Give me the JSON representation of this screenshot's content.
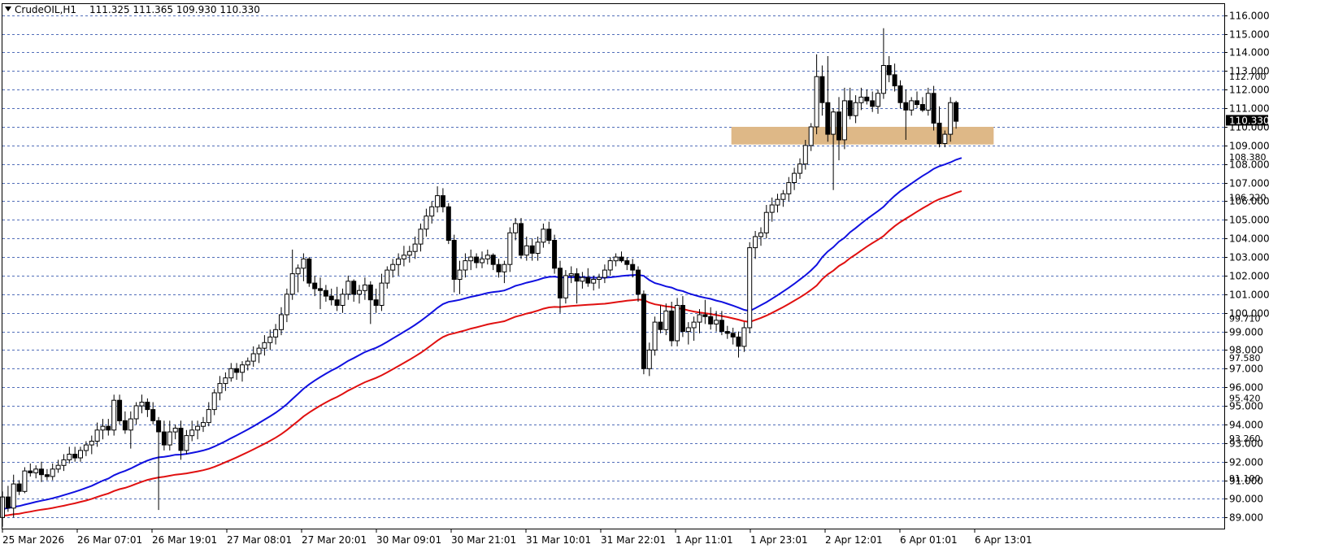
{
  "header": {
    "symbol_label": "CrudeOIL,H1",
    "ohlc": "111.325 111.365 109.930 110.330"
  },
  "colors": {
    "background": "#ffffff",
    "grid": "#1a3fa3",
    "ma_fast": "#1010e0",
    "ma_slow": "#e01010",
    "zone": "#deb887",
    "candle_up_fill": "#ffffff",
    "candle_down_fill": "#000000"
  },
  "chart_data": {
    "type": "candlestick",
    "ylim": [
      88.4,
      116.6
    ],
    "grid": true,
    "y_ticks": [
      116,
      115,
      114,
      113,
      112,
      111,
      110,
      109,
      108,
      107,
      106,
      105,
      104,
      103,
      102,
      101,
      100,
      99,
      98,
      97,
      96,
      95,
      94,
      93,
      92,
      91,
      90,
      89
    ],
    "y_tick_labels": [
      "116.000",
      "115.000",
      "114.000",
      "113.000",
      "112.000",
      "111.000",
      "110.000",
      "109.000",
      "108.000",
      "107.000",
      "106.000",
      "105.000",
      "104.000",
      "103.000",
      "102.000",
      "101.000",
      "100.000",
      "99.000",
      "98.000",
      "97.000",
      "96.000",
      "95.000",
      "94.000",
      "93.000",
      "92.000",
      "91.000",
      "90.000",
      "89.000"
    ],
    "extra_price_labels": [
      {
        "label": "112.700",
        "value": 112.7
      },
      {
        "label": "108.380",
        "value": 108.38
      },
      {
        "label": "106.220",
        "value": 106.22
      },
      {
        "label": "99.710",
        "value": 99.71
      },
      {
        "label": "97.580",
        "value": 97.58
      },
      {
        "label": "95.420",
        "value": 95.42
      },
      {
        "label": "93.260",
        "value": 93.26
      },
      {
        "label": "91.100",
        "value": 91.1
      }
    ],
    "current_price": {
      "label": "110.330",
      "value": 110.33
    },
    "x_labels": [
      "25 Mar 2026",
      "26 Mar 07:01",
      "26 Mar 19:01",
      "27 Mar 08:01",
      "27 Mar 20:01",
      "30 Mar 09:01",
      "30 Mar 21:01",
      "31 Mar 10:01",
      "31 Mar 22:01",
      "1 Apr 11:01",
      "1 Apr 23:01",
      "2 Apr 12:01",
      "6 Apr 01:01",
      "6 Apr 13:01"
    ],
    "zone": {
      "low": 109.05,
      "high": 110.0,
      "from_bar": 131,
      "to_bar": 176
    },
    "candles": [
      [
        89.0,
        90.4,
        88.5,
        90.1
      ],
      [
        90.1,
        90.7,
        89.3,
        89.5
      ],
      [
        89.5,
        91.3,
        89.0,
        90.8
      ],
      [
        90.8,
        91.0,
        90.2,
        90.4
      ],
      [
        90.4,
        91.7,
        90.3,
        91.5
      ],
      [
        91.5,
        91.9,
        91.2,
        91.4
      ],
      [
        91.4,
        91.8,
        91.1,
        91.6
      ],
      [
        91.6,
        92.0,
        90.9,
        91.3
      ],
      [
        91.3,
        91.6,
        91.0,
        91.2
      ],
      [
        91.2,
        91.9,
        91.0,
        91.6
      ],
      [
        91.6,
        92.1,
        91.4,
        91.8
      ],
      [
        91.8,
        92.4,
        91.5,
        92.1
      ],
      [
        92.1,
        92.8,
        91.9,
        92.4
      ],
      [
        92.4,
        92.8,
        92.0,
        92.2
      ],
      [
        92.2,
        92.8,
        92.0,
        92.6
      ],
      [
        92.6,
        93.1,
        92.3,
        92.9
      ],
      [
        92.9,
        93.4,
        92.4,
        93.1
      ],
      [
        93.1,
        94.1,
        92.8,
        93.7
      ],
      [
        93.7,
        94.3,
        93.2,
        93.9
      ],
      [
        93.9,
        94.3,
        93.4,
        93.7
      ],
      [
        93.7,
        95.6,
        93.4,
        95.3
      ],
      [
        95.3,
        95.6,
        94.0,
        94.2
      ],
      [
        94.2,
        94.7,
        93.5,
        93.7
      ],
      [
        93.7,
        94.7,
        92.7,
        94.3
      ],
      [
        94.3,
        95.2,
        94.0,
        95.0
      ],
      [
        95.0,
        95.6,
        94.6,
        95.2
      ],
      [
        95.2,
        95.4,
        94.4,
        94.8
      ],
      [
        94.8,
        95.2,
        94.0,
        94.2
      ],
      [
        94.2,
        94.4,
        89.4,
        93.6
      ],
      [
        93.6,
        94.2,
        92.6,
        92.9
      ],
      [
        92.9,
        94.2,
        92.6,
        93.6
      ],
      [
        93.6,
        94.0,
        93.2,
        93.8
      ],
      [
        93.8,
        94.2,
        92.1,
        92.6
      ],
      [
        92.6,
        93.7,
        92.4,
        93.4
      ],
      [
        93.4,
        94.2,
        93.1,
        93.7
      ],
      [
        93.7,
        94.2,
        93.2,
        93.9
      ],
      [
        93.9,
        94.4,
        93.6,
        94.1
      ],
      [
        94.1,
        95.2,
        93.9,
        94.8
      ],
      [
        94.8,
        95.9,
        94.5,
        95.7
      ],
      [
        95.7,
        96.6,
        95.3,
        96.2
      ],
      [
        96.2,
        96.8,
        95.8,
        96.5
      ],
      [
        96.5,
        97.3,
        96.3,
        97.0
      ],
      [
        97.0,
        97.3,
        96.4,
        96.8
      ],
      [
        96.8,
        97.4,
        96.3,
        97.2
      ],
      [
        97.2,
        97.6,
        96.9,
        97.4
      ],
      [
        97.4,
        98.2,
        97.1,
        97.8
      ],
      [
        97.8,
        98.3,
        97.3,
        98.1
      ],
      [
        98.1,
        98.8,
        97.7,
        98.4
      ],
      [
        98.4,
        99.1,
        98.0,
        98.7
      ],
      [
        98.7,
        99.4,
        98.3,
        99.1
      ],
      [
        99.1,
        100.3,
        98.8,
        99.9
      ],
      [
        99.9,
        101.3,
        99.5,
        101.0
      ],
      [
        101.0,
        103.4,
        100.7,
        102.1
      ],
      [
        102.1,
        102.6,
        101.1,
        102.4
      ],
      [
        102.4,
        103.2,
        101.7,
        102.9
      ],
      [
        102.9,
        103.0,
        101.4,
        101.6
      ],
      [
        101.6,
        102.0,
        100.9,
        101.3
      ],
      [
        101.3,
        101.9,
        100.2,
        101.2
      ],
      [
        101.2,
        101.5,
        100.6,
        100.9
      ],
      [
        100.9,
        101.3,
        100.4,
        100.7
      ],
      [
        100.7,
        101.4,
        100.1,
        100.4
      ],
      [
        100.4,
        101.3,
        100.0,
        101.0
      ],
      [
        101.0,
        102.0,
        100.7,
        101.7
      ],
      [
        101.7,
        101.8,
        100.6,
        101.0
      ],
      [
        101.0,
        101.5,
        100.5,
        101.2
      ],
      [
        101.2,
        101.9,
        100.7,
        101.5
      ],
      [
        101.5,
        101.7,
        99.4,
        100.7
      ],
      [
        100.7,
        101.3,
        100.0,
        100.4
      ],
      [
        100.4,
        102.1,
        100.1,
        101.6
      ],
      [
        101.6,
        102.5,
        101.3,
        102.3
      ],
      [
        102.3,
        102.9,
        101.9,
        102.6
      ],
      [
        102.6,
        103.2,
        102.0,
        102.9
      ],
      [
        102.9,
        103.6,
        102.5,
        103.1
      ],
      [
        103.1,
        103.6,
        102.7,
        103.3
      ],
      [
        103.3,
        104.1,
        102.9,
        103.7
      ],
      [
        103.7,
        104.8,
        103.3,
        104.5
      ],
      [
        104.5,
        105.6,
        104.1,
        105.2
      ],
      [
        105.2,
        106.0,
        104.8,
        105.7
      ],
      [
        105.7,
        106.8,
        105.4,
        106.3
      ],
      [
        106.3,
        106.7,
        105.4,
        105.7
      ],
      [
        105.7,
        105.9,
        103.7,
        103.9
      ],
      [
        103.9,
        104.2,
        101.1,
        101.8
      ],
      [
        101.8,
        102.8,
        101.0,
        102.3
      ],
      [
        102.3,
        103.2,
        101.9,
        102.8
      ],
      [
        102.8,
        103.4,
        102.3,
        103.0
      ],
      [
        103.0,
        103.2,
        102.4,
        102.7
      ],
      [
        102.7,
        103.3,
        102.4,
        102.9
      ],
      [
        102.9,
        103.4,
        102.6,
        103.1
      ],
      [
        103.1,
        103.2,
        102.3,
        102.6
      ],
      [
        102.6,
        102.9,
        101.9,
        102.2
      ],
      [
        102.2,
        102.8,
        101.6,
        102.6
      ],
      [
        102.6,
        104.6,
        102.2,
        104.3
      ],
      [
        104.3,
        105.1,
        103.9,
        104.8
      ],
      [
        104.8,
        105.1,
        102.9,
        103.1
      ],
      [
        103.1,
        104.1,
        102.8,
        103.6
      ],
      [
        103.6,
        104.0,
        102.8,
        103.2
      ],
      [
        103.2,
        104.1,
        102.8,
        103.8
      ],
      [
        103.8,
        104.8,
        103.5,
        104.5
      ],
      [
        104.5,
        104.9,
        103.7,
        103.9
      ],
      [
        103.9,
        104.2,
        102.1,
        102.4
      ],
      [
        102.4,
        102.8,
        100.0,
        100.8
      ],
      [
        100.8,
        102.3,
        100.5,
        102.0
      ],
      [
        102.0,
        102.5,
        101.6,
        102.1
      ],
      [
        102.1,
        102.4,
        100.5,
        101.7
      ],
      [
        101.7,
        102.2,
        101.3,
        101.9
      ],
      [
        101.9,
        102.4,
        101.4,
        101.6
      ],
      [
        101.6,
        102.0,
        101.2,
        101.8
      ],
      [
        101.8,
        102.1,
        101.3,
        101.9
      ],
      [
        101.9,
        102.6,
        101.6,
        102.3
      ],
      [
        102.3,
        103.0,
        102.0,
        102.8
      ],
      [
        102.8,
        103.2,
        102.5,
        103.0
      ],
      [
        103.0,
        103.3,
        102.7,
        102.8
      ],
      [
        102.8,
        103.0,
        102.3,
        102.6
      ],
      [
        102.6,
        102.9,
        101.9,
        102.3
      ],
      [
        102.3,
        102.5,
        100.6,
        101.0
      ],
      [
        101.0,
        101.2,
        96.7,
        97.0
      ],
      [
        97.0,
        98.4,
        96.6,
        98.0
      ],
      [
        98.0,
        99.8,
        97.7,
        99.5
      ],
      [
        99.5,
        100.4,
        98.9,
        99.1
      ],
      [
        99.1,
        100.5,
        98.8,
        100.1
      ],
      [
        100.1,
        100.6,
        98.2,
        98.5
      ],
      [
        98.5,
        100.8,
        98.2,
        100.4
      ],
      [
        100.4,
        100.9,
        98.7,
        99.0
      ],
      [
        99.0,
        99.5,
        98.3,
        99.2
      ],
      [
        99.2,
        99.8,
        98.5,
        99.5
      ],
      [
        99.5,
        100.2,
        98.9,
        99.9
      ],
      [
        99.9,
        100.7,
        99.4,
        99.8
      ],
      [
        99.8,
        100.3,
        99.1,
        99.4
      ],
      [
        99.4,
        100.1,
        99.0,
        99.6
      ],
      [
        99.6,
        100.1,
        98.8,
        99.0
      ],
      [
        99.0,
        99.3,
        98.6,
        98.9
      ],
      [
        98.9,
        99.2,
        98.3,
        98.7
      ],
      [
        98.7,
        99.0,
        97.6,
        98.2
      ],
      [
        98.2,
        99.5,
        97.9,
        99.2
      ],
      [
        99.2,
        103.8,
        98.9,
        103.5
      ],
      [
        103.5,
        104.4,
        102.9,
        104.1
      ],
      [
        104.1,
        104.6,
        103.6,
        104.3
      ],
      [
        104.3,
        105.8,
        104.0,
        105.4
      ],
      [
        105.4,
        106.2,
        104.9,
        105.8
      ],
      [
        105.8,
        106.4,
        105.4,
        106.1
      ],
      [
        106.1,
        106.6,
        105.7,
        106.4
      ],
      [
        106.4,
        107.3,
        106.0,
        107.0
      ],
      [
        107.0,
        107.8,
        106.6,
        107.5
      ],
      [
        107.5,
        108.3,
        107.2,
        108.0
      ],
      [
        108.0,
        109.3,
        107.7,
        109.0
      ],
      [
        109.0,
        110.2,
        108.7,
        110.0
      ],
      [
        110.0,
        113.9,
        109.6,
        112.7
      ],
      [
        112.7,
        113.3,
        110.6,
        111.3
      ],
      [
        111.3,
        113.8,
        109.2,
        109.6
      ],
      [
        109.6,
        111.0,
        106.6,
        110.8
      ],
      [
        110.8,
        111.6,
        108.2,
        109.3
      ],
      [
        109.3,
        112.1,
        108.8,
        111.4
      ],
      [
        111.4,
        112.1,
        110.4,
        110.6
      ],
      [
        110.6,
        111.7,
        110.2,
        111.3
      ],
      [
        111.3,
        112.1,
        110.9,
        111.6
      ],
      [
        111.6,
        112.0,
        111.2,
        111.4
      ],
      [
        111.4,
        111.9,
        110.8,
        111.1
      ],
      [
        111.1,
        112.0,
        110.7,
        111.8
      ],
      [
        111.8,
        115.3,
        111.5,
        113.3
      ],
      [
        113.3,
        113.8,
        112.4,
        112.8
      ],
      [
        112.8,
        113.4,
        111.9,
        112.2
      ],
      [
        112.2,
        112.5,
        111.0,
        111.3
      ],
      [
        111.3,
        112.0,
        109.3,
        110.9
      ],
      [
        110.9,
        111.6,
        110.6,
        111.4
      ],
      [
        111.4,
        111.9,
        111.0,
        111.2
      ],
      [
        111.2,
        111.6,
        110.8,
        110.9
      ],
      [
        110.9,
        112.1,
        110.6,
        111.8
      ],
      [
        111.8,
        112.2,
        109.8,
        110.2
      ],
      [
        110.2,
        111.1,
        108.9,
        109.1
      ],
      [
        109.1,
        109.8,
        108.9,
        109.6
      ],
      [
        109.6,
        111.6,
        109.2,
        111.3
      ],
      [
        111.3,
        111.4,
        109.9,
        110.3
      ]
    ],
    "ma_fast": [
      89.45,
      89.5,
      89.57,
      89.61,
      89.69,
      89.76,
      89.84,
      89.9,
      89.96,
      90.03,
      90.11,
      90.2,
      90.29,
      90.38,
      90.48,
      90.59,
      90.7,
      90.84,
      90.98,
      91.09,
      91.27,
      91.4,
      91.5,
      91.63,
      91.78,
      91.93,
      92.06,
      92.16,
      92.23,
      92.26,
      92.31,
      92.37,
      92.38,
      92.42,
      92.47,
      92.53,
      92.6,
      92.69,
      92.81,
      92.95,
      93.1,
      93.26,
      93.41,
      93.57,
      93.73,
      93.9,
      94.08,
      94.26,
      94.44,
      94.63,
      94.85,
      95.09,
      95.37,
      95.64,
      95.92,
      96.15,
      96.36,
      96.55,
      96.73,
      96.9,
      97.05,
      97.23,
      97.42,
      97.57,
      97.73,
      97.89,
      98.01,
      98.12,
      98.27,
      98.44,
      98.62,
      98.8,
      98.98,
      99.16,
      99.35,
      99.56,
      99.79,
      100.02,
      100.27,
      100.47,
      100.59,
      100.64,
      100.7,
      100.78,
      100.86,
      100.92,
      100.99,
      101.07,
      101.12,
      101.15,
      101.2,
      101.32,
      101.45,
      101.53,
      101.62,
      101.69,
      101.77,
      101.87,
      101.93,
      101.95,
      101.9,
      101.91,
      101.92,
      101.91,
      101.91,
      101.9,
      101.89,
      101.89,
      101.89,
      101.91,
      101.94,
      101.98,
      102.01,
      102.03,
      102.04,
      101.99,
      101.76,
      101.6,
      101.52,
      101.42,
      101.36,
      101.23,
      101.17,
      101.05,
      100.96,
      100.88,
      100.81,
      100.75,
      100.66,
      100.59,
      100.49,
      100.39,
      100.28,
      100.16,
      100.1,
      100.25,
      100.41,
      100.57,
      100.76,
      100.95,
      101.15,
      101.35,
      101.56,
      101.79,
      102.02,
      102.28,
      102.58,
      102.99,
      103.3,
      103.53,
      103.83,
      104.04,
      104.33,
      104.56,
      104.8,
      105.04,
      105.26,
      105.47,
      105.7,
      106.01,
      106.29,
      106.54,
      106.74,
      106.95,
      107.16,
      107.36,
      107.54,
      107.74,
      107.88,
      107.98,
      108.09,
      108.23,
      108.33
    ],
    "ma_slow": [
      89.09,
      89.12,
      89.17,
      89.2,
      89.26,
      89.31,
      89.37,
      89.42,
      89.46,
      89.51,
      89.57,
      89.63,
      89.7,
      89.76,
      89.84,
      89.91,
      90.0,
      90.1,
      90.2,
      90.29,
      90.42,
      90.52,
      90.59,
      90.69,
      90.81,
      90.92,
      91.02,
      91.09,
      91.15,
      91.19,
      91.24,
      91.3,
      91.33,
      91.37,
      91.42,
      91.48,
      91.54,
      91.62,
      91.72,
      91.84,
      91.97,
      92.1,
      92.23,
      92.37,
      92.51,
      92.66,
      92.81,
      92.96,
      93.12,
      93.29,
      93.48,
      93.7,
      93.94,
      94.18,
      94.43,
      94.64,
      94.83,
      95.01,
      95.18,
      95.34,
      95.48,
      95.64,
      95.82,
      95.97,
      96.12,
      96.27,
      96.39,
      96.5,
      96.64,
      96.8,
      96.97,
      97.14,
      97.31,
      97.48,
      97.66,
      97.85,
      98.06,
      98.28,
      98.51,
      98.7,
      98.83,
      98.9,
      98.98,
      99.06,
      99.15,
      99.22,
      99.3,
      99.38,
      99.44,
      99.49,
      99.55,
      99.67,
      99.79,
      99.87,
      99.96,
      100.03,
      100.12,
      100.22,
      100.29,
      100.32,
      100.31,
      100.34,
      100.37,
      100.39,
      100.41,
      100.43,
      100.45,
      100.47,
      100.49,
      100.53,
      100.57,
      100.61,
      100.65,
      100.68,
      100.71,
      100.69,
      100.55,
      100.46,
      100.41,
      100.35,
      100.32,
      100.24,
      100.21,
      100.13,
      100.07,
      100.02,
      99.98,
      99.94,
      99.88,
      99.83,
      99.77,
      99.7,
      99.63,
      99.55,
      99.51,
      99.62,
      99.73,
      99.85,
      100.0,
      100.15,
      100.31,
      100.48,
      100.65,
      100.83,
      101.02,
      101.23,
      101.47,
      101.81,
      102.07,
      102.27,
      102.52,
      102.7,
      102.94,
      103.14,
      103.35,
      103.56,
      103.75,
      103.93,
      104.13,
      104.41,
      104.66,
      104.88,
      105.06,
      105.25,
      105.44,
      105.62,
      105.79,
      105.97,
      106.11,
      106.21,
      106.32,
      106.45,
      106.55
    ]
  }
}
